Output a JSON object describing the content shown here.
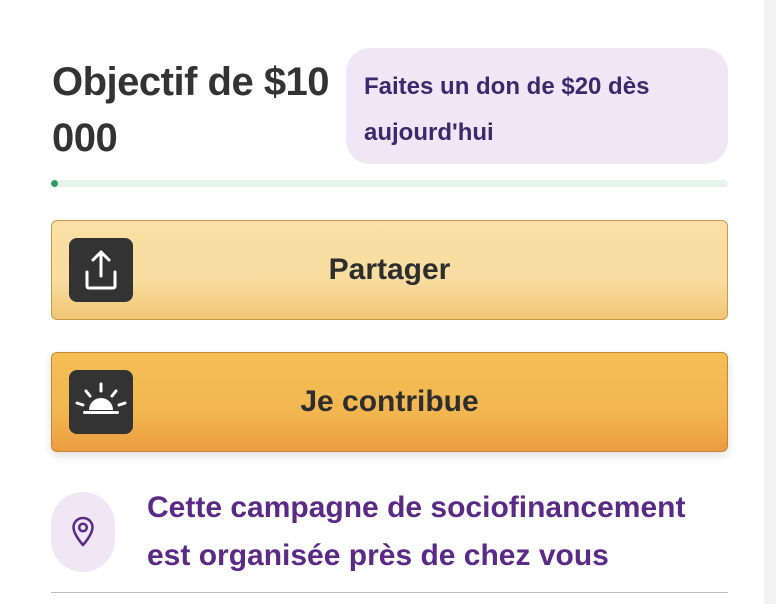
{
  "goal": {
    "title": "Objectif de $10 000"
  },
  "cta_badge": {
    "text": "Faites un don de $20 dès aujourd'hui"
  },
  "progress": {
    "fraction": 0.01,
    "track_color": "#e6f4ee",
    "fill_color": "#2f9d63"
  },
  "buttons": {
    "share": {
      "label": "Partager",
      "icon": "share-upload-icon"
    },
    "contribute": {
      "label": "Je contribue",
      "icon": "sunrise-icon"
    }
  },
  "location": {
    "text": "Cette campagne de sociofinancement est organisée près de chez vous",
    "icon": "map-pin-icon"
  },
  "colors": {
    "accent_purple": "#5b2a86",
    "badge_bg": "#efe7f6",
    "share_bg": "#f8dca0",
    "contribute_bg": "#f2b650",
    "icon_bg": "#333333"
  }
}
